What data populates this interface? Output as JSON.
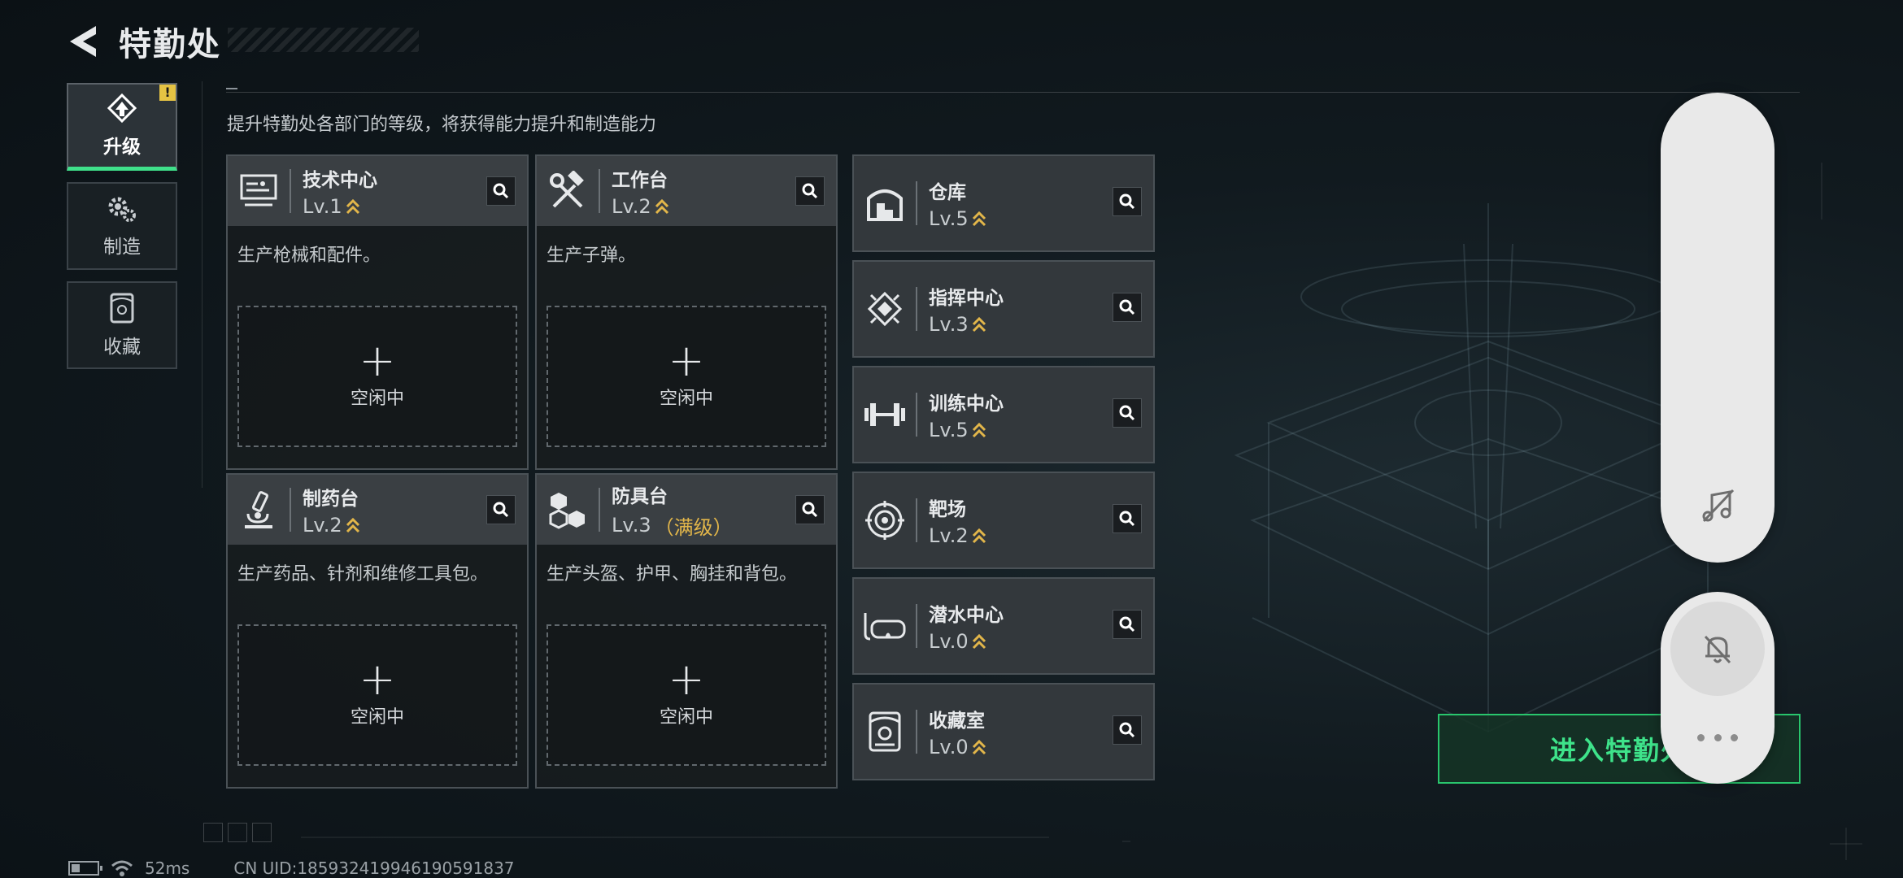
{
  "header": {
    "title": "特勤处"
  },
  "tabs": [
    {
      "label": "升级",
      "active": true,
      "badge": "!"
    },
    {
      "label": "制造",
      "active": false
    },
    {
      "label": "收藏",
      "active": false
    }
  ],
  "subtitle": "提升特勤处各部门的等级，将获得能力提升和制造能力",
  "cards": [
    {
      "name": "技术中心",
      "level": "Lv.1",
      "desc": "生产枪械和配件。",
      "slot_plus": "+",
      "slot_label": "空闲中",
      "icon": "monitor-icon"
    },
    {
      "name": "工作台",
      "level": "Lv.2",
      "desc": "生产子弹。",
      "slot_plus": "+",
      "slot_label": "空闲中",
      "icon": "tools-icon"
    },
    {
      "name": "制药台",
      "level": "Lv.2",
      "desc": "生产药品、针剂和维修工具包。",
      "slot_plus": "+",
      "slot_label": "空闲中",
      "icon": "microscope-icon"
    },
    {
      "name": "防具台",
      "level": "Lv.3",
      "max_label": "（满级）",
      "desc": "生产头盔、护甲、胸挂和背包。",
      "slot_plus": "+",
      "slot_label": "空闲中",
      "icon": "armor-crates-icon"
    }
  ],
  "departments": [
    {
      "name": "仓库",
      "level": "Lv.5",
      "icon": "warehouse-icon"
    },
    {
      "name": "指挥中心",
      "level": "Lv.3",
      "icon": "chip-icon"
    },
    {
      "name": "训练中心",
      "level": "Lv.5",
      "icon": "dumbbell-icon"
    },
    {
      "name": "靶场",
      "level": "Lv.2",
      "icon": "target-icon"
    },
    {
      "name": "潜水中心",
      "level": "Lv.0",
      "icon": "diving-mask-icon"
    },
    {
      "name": "收藏室",
      "level": "Lv.0",
      "icon": "collection-icon"
    }
  ],
  "enter_button": {
    "label": "进入特勤处"
  },
  "status": {
    "ping": "52ms",
    "uid": "CN UID:185932419946190591837"
  },
  "colors": {
    "accent_green": "#3fe08a",
    "upgrade_gold": "#e2b64a",
    "warning_yellow": "#e5c343"
  }
}
